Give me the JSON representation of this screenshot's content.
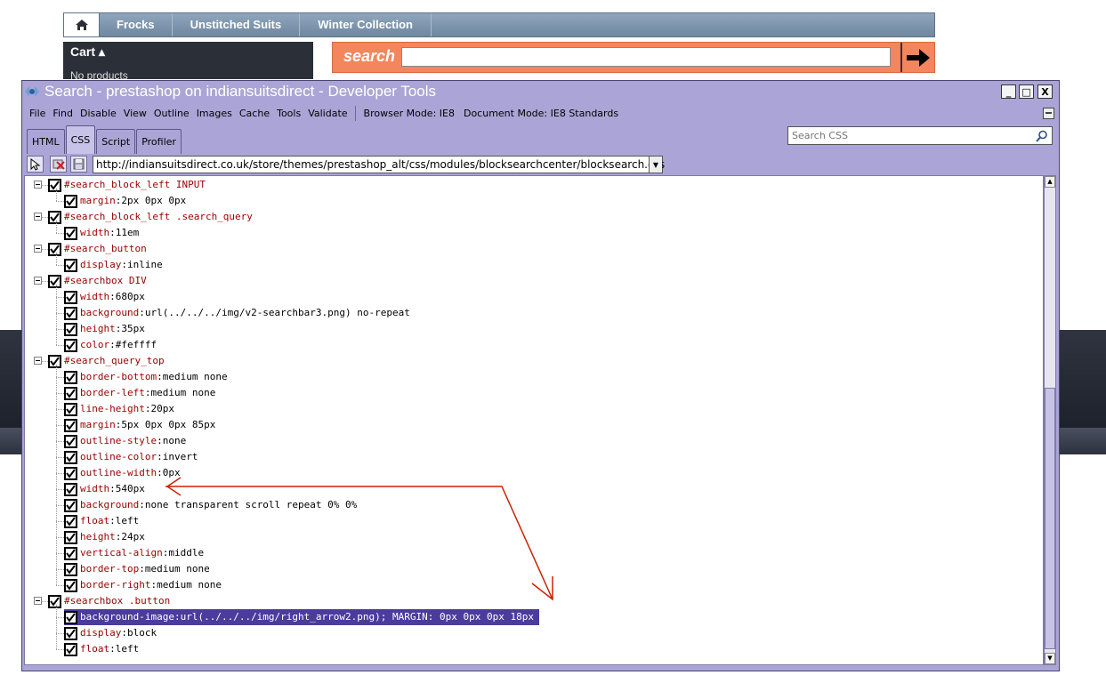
{
  "site": {
    "nav": {
      "items": [
        "Frocks",
        "Unstitched Suits",
        "Winter Collection"
      ]
    },
    "cart": {
      "title": "Cart ▴",
      "empty_text": "No products"
    },
    "search": {
      "label": "search",
      "value": ""
    }
  },
  "devtools": {
    "title": "Search - prestashop on indiansuitsdirect - Developer Tools",
    "window_buttons": [
      "_",
      "□",
      "X"
    ],
    "menu": [
      "File",
      "Find",
      "Disable",
      "View",
      "Outline",
      "Images",
      "Cache",
      "Tools",
      "Validate"
    ],
    "browser_mode": "Browser Mode: IE8",
    "document_mode": "Document Mode: IE8 Standards",
    "tabs": [
      "HTML",
      "CSS",
      "Script",
      "Profiler"
    ],
    "active_tab": "CSS",
    "css_search_placeholder": "Search CSS",
    "stylesheet_url": "http://indiansuitsdirect.co.uk/store/themes/prestashop_alt/css/modules/blocksearchcenter/blocksearch.css",
    "rules": [
      {
        "selector": "#search_block_left INPUT",
        "props": [
          {
            "name": "margin",
            "value": "2px 0px 0px"
          }
        ]
      },
      {
        "selector": "#search_block_left .search_query",
        "props": [
          {
            "name": "width",
            "value": "11em"
          }
        ]
      },
      {
        "selector": "#search_button",
        "props": [
          {
            "name": "display",
            "value": "inline"
          }
        ]
      },
      {
        "selector": "#searchbox DIV",
        "props": [
          {
            "name": "width",
            "value": "680px"
          },
          {
            "name": "background",
            "value": "url(../../../img/v2-searchbar3.png) no-repeat"
          },
          {
            "name": "height",
            "value": "35px"
          },
          {
            "name": "color",
            "value": "#feffff"
          }
        ]
      },
      {
        "selector": "#search_query_top",
        "props": [
          {
            "name": "border-bottom",
            "value": "medium none"
          },
          {
            "name": "border-left",
            "value": "medium none"
          },
          {
            "name": "line-height",
            "value": "20px"
          },
          {
            "name": "margin",
            "value": "5px 0px 0px 85px"
          },
          {
            "name": "outline-style",
            "value": "none"
          },
          {
            "name": "outline-color",
            "value": "invert"
          },
          {
            "name": "outline-width",
            "value": "0px"
          },
          {
            "name": "width",
            "value": "540px"
          },
          {
            "name": "background",
            "value": "none transparent scroll repeat 0% 0%"
          },
          {
            "name": "float",
            "value": "left"
          },
          {
            "name": "height",
            "value": "24px"
          },
          {
            "name": "vertical-align",
            "value": "middle"
          },
          {
            "name": "border-top",
            "value": "medium none"
          },
          {
            "name": "border-right",
            "value": "medium none"
          }
        ]
      },
      {
        "selector": "#searchbox .button",
        "props": [
          {
            "name": "background-image",
            "value": "url(../../../img/right_arrow2.png); MARGIN: 0px 0px 0px 18px",
            "highlighted": true
          },
          {
            "name": "display",
            "value": "block"
          },
          {
            "name": "float",
            "value": "left"
          }
        ]
      }
    ]
  },
  "colors": {
    "devtools_chrome": "#aaa5d6",
    "selector_text": "#990000",
    "highlight": "#4b3c9c",
    "search_orange": "#f3865c",
    "annotation_arrow": "#cc2200"
  }
}
